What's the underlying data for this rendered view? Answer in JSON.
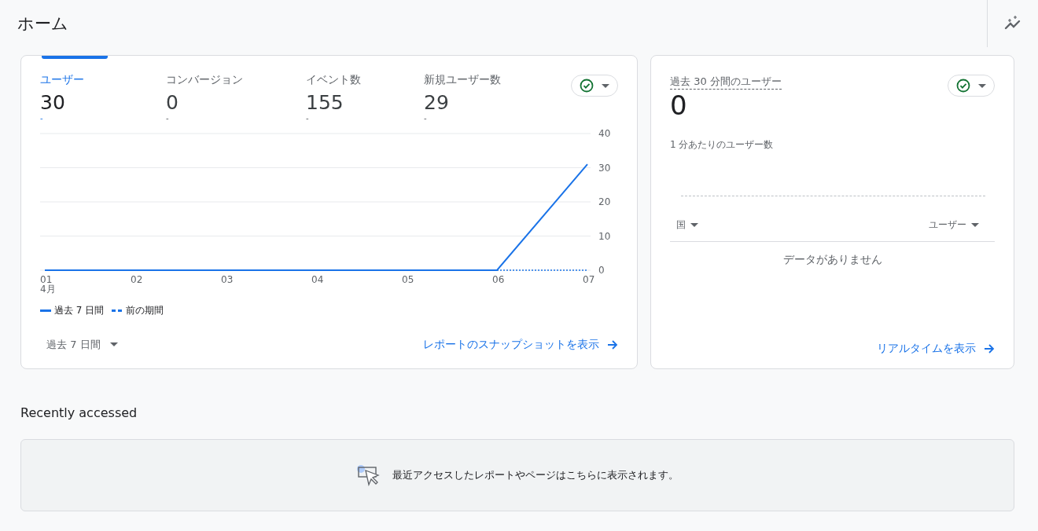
{
  "page_title": "ホーム",
  "overview": {
    "metrics": [
      {
        "label": "ユーザー",
        "value": "30",
        "change": "-",
        "selected": true
      },
      {
        "label": "コンバージョン",
        "value": "0",
        "change": "-",
        "selected": false
      },
      {
        "label": "イベント数",
        "value": "155",
        "change": "-",
        "selected": false
      },
      {
        "label": "新規ユーザー数",
        "value": "29",
        "change": "-",
        "selected": false
      }
    ],
    "chart_data": {
      "type": "line",
      "categories": [
        "01",
        "02",
        "03",
        "04",
        "05",
        "06",
        "07"
      ],
      "annotations": [
        "4月"
      ],
      "grid": true,
      "legend": "bottom",
      "ylim": [
        0,
        40
      ],
      "yticks": [
        0,
        10,
        20,
        30,
        40
      ],
      "series": [
        {
          "name": "過去 7 日間",
          "color": "#1a73e8",
          "line_style": "solid",
          "values": [
            0,
            0,
            0,
            0,
            0,
            0,
            31
          ]
        },
        {
          "name": "前の期間",
          "color": "#1a73e8",
          "line_style": "dashed",
          "values": [
            null,
            null,
            null,
            null,
            null,
            0,
            0
          ]
        }
      ]
    },
    "date_range": "過去 7 日間",
    "link": "レポートのスナップショットを表示"
  },
  "realtime": {
    "title": "過去 30 分間のユーザー",
    "value": "0",
    "subtitle": "1 分あたりのユーザー数",
    "columns": [
      "国",
      "ユーザー"
    ],
    "empty_message": "データがありません",
    "link": "リアルタイムを表示"
  },
  "recent": {
    "heading": "Recently accessed",
    "empty_message": "最近アクセスしたレポートやページはこちらに表示されます。"
  }
}
